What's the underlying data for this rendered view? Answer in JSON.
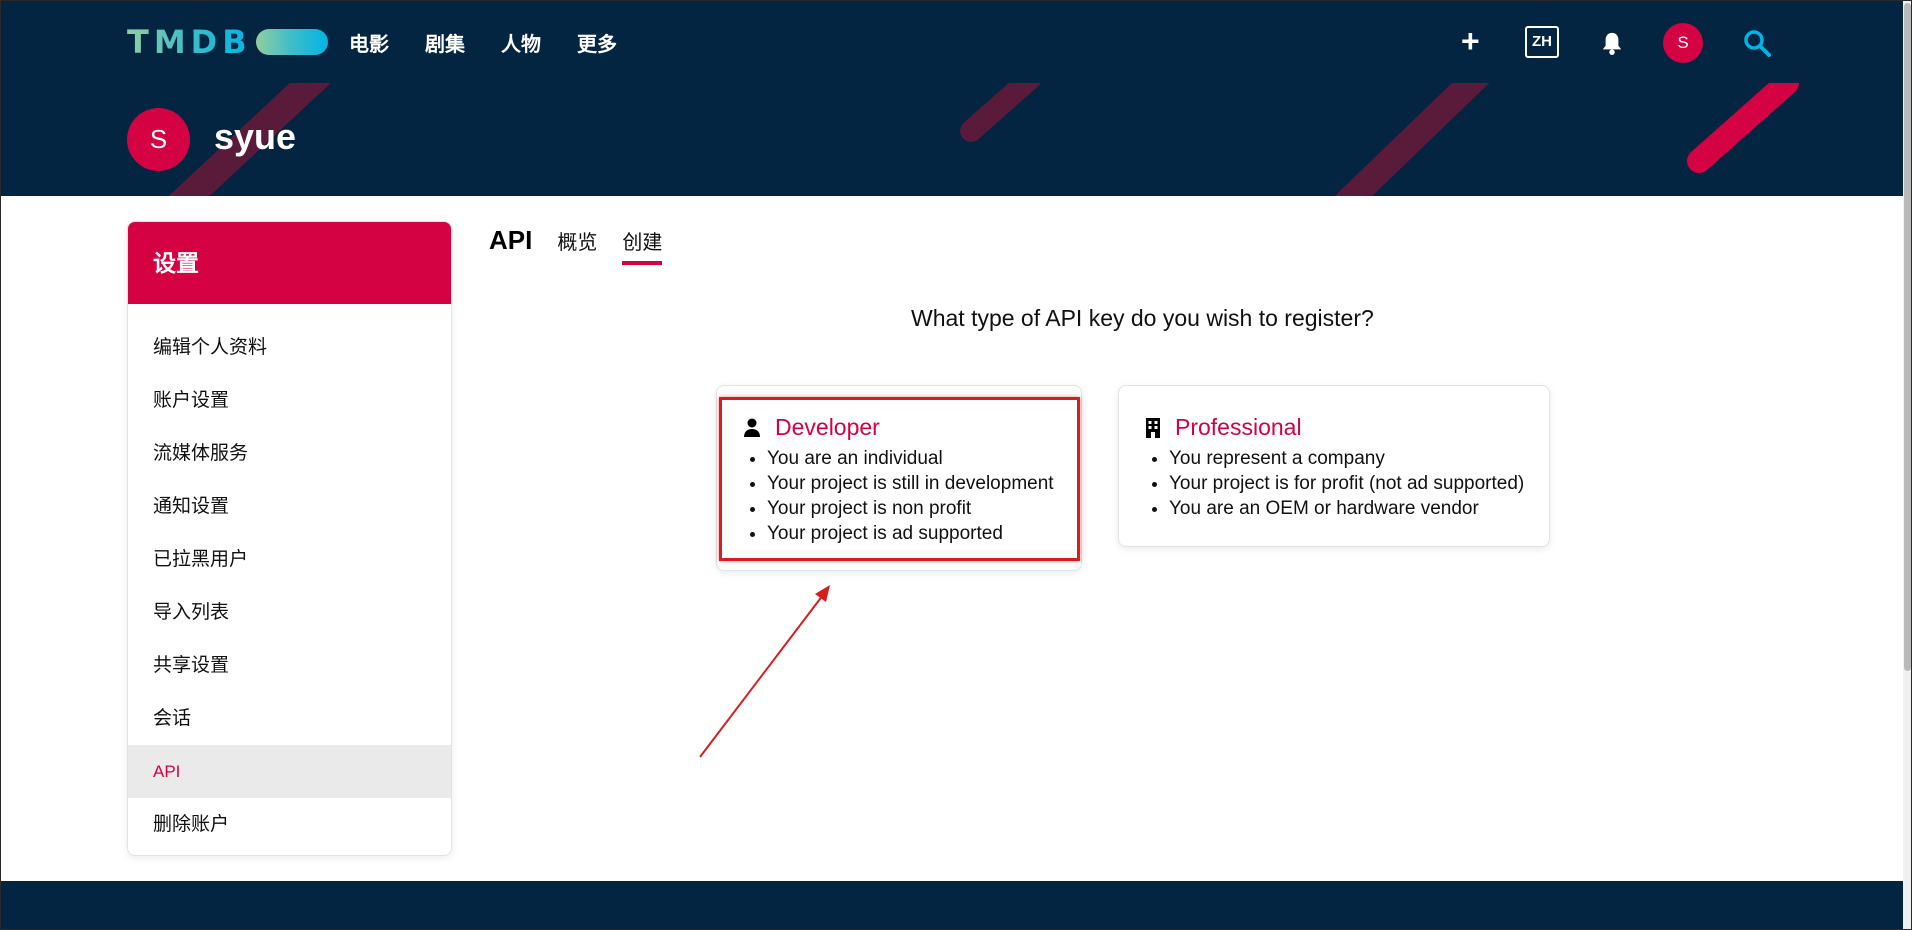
{
  "nav": {
    "logo": "TMDB",
    "links": [
      "电影",
      "剧集",
      "人物",
      "更多"
    ],
    "plus": "+",
    "lang": "ZH",
    "avatar_letter": "S"
  },
  "profile": {
    "avatar_letter": "S",
    "name": "syue"
  },
  "sidebar": {
    "title": "设置",
    "items": [
      {
        "label": "编辑个人资料"
      },
      {
        "label": "账户设置"
      },
      {
        "label": "流媒体服务"
      },
      {
        "label": "通知设置"
      },
      {
        "label": "已拉黑用户"
      },
      {
        "label": "导入列表"
      },
      {
        "label": "共享设置"
      },
      {
        "label": "会话"
      },
      {
        "label": "API"
      },
      {
        "label": "删除账户"
      }
    ],
    "active_item": "API"
  },
  "main": {
    "section_title": "API",
    "tabs": [
      {
        "label": "概览"
      },
      {
        "label": "创建"
      }
    ],
    "selected_tab": "创建",
    "question": "What type of API key do you wish to register?",
    "cards": [
      {
        "title": "Developer",
        "icon": "person-icon",
        "bullets": [
          "You are an individual",
          "Your project is still in development",
          "Your project is non profit",
          "Your project is ad supported"
        ]
      },
      {
        "title": "Professional",
        "icon": "building-icon",
        "bullets": [
          "You represent a company",
          "Your project is for profit (not ad supported)",
          "You are an OEM or hardware vendor"
        ]
      }
    ]
  },
  "colors": {
    "nav_bg": "#042541",
    "accent": "#d40242",
    "annotation": "#d61e1e"
  }
}
